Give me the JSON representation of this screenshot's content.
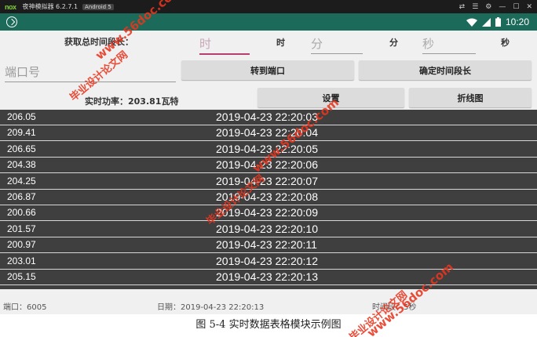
{
  "emulator": {
    "logo": "nox",
    "title": "夜神模拟器 6.2.7.1",
    "android_badge": "Android 5",
    "controls": [
      "⇄",
      "☰",
      "⚙",
      "—",
      "☐",
      "✕"
    ]
  },
  "status_bar": {
    "time": "10:20"
  },
  "form": {
    "total_label": "获取总时间段长：",
    "hour_placeholder": "时",
    "hour_label": "时",
    "minute_placeholder": "分",
    "minute_label": "分",
    "second_placeholder": "秒",
    "second_label": "秒",
    "port_placeholder": "端口号",
    "goto_port_label": "转到端口",
    "confirm_duration_label": "确定时间段长",
    "realtime_power": "实时功率：203.81瓦特",
    "settings_label": "设置",
    "line_chart_label": "折线图"
  },
  "table": {
    "rows": [
      {
        "value": "206.05",
        "time": "2019-04-23 22:20:03"
      },
      {
        "value": "209.41",
        "time": "2019-04-23 22:20:04"
      },
      {
        "value": "206.65",
        "time": "2019-04-23 22:20:05"
      },
      {
        "value": "204.38",
        "time": "2019-04-23 22:20:06"
      },
      {
        "value": "204.25",
        "time": "2019-04-23 22:20:07"
      },
      {
        "value": "206.87",
        "time": "2019-04-23 22:20:08"
      },
      {
        "value": "200.66",
        "time": "2019-04-23 22:20:09"
      },
      {
        "value": "201.57",
        "time": "2019-04-23 22:20:10"
      },
      {
        "value": "200.97",
        "time": "2019-04-23 22:20:11"
      },
      {
        "value": "203.01",
        "time": "2019-04-23 22:20:12"
      },
      {
        "value": "205.15",
        "time": "2019-04-23 22:20:13"
      }
    ]
  },
  "footer": {
    "port": "端口：6005",
    "date": "日期：2019-04-23 22:20:13",
    "duration": "时间段：5秒"
  },
  "caption": "图 5-4  实时数据表格模块示例图",
  "watermarks": {
    "site": "www.56doc.com",
    "cn": "毕业设计论文网"
  },
  "colors": {
    "status_bar": "#1b6a5a",
    "table_bg": "#3f3f3f",
    "watermark": "#e8361f"
  }
}
